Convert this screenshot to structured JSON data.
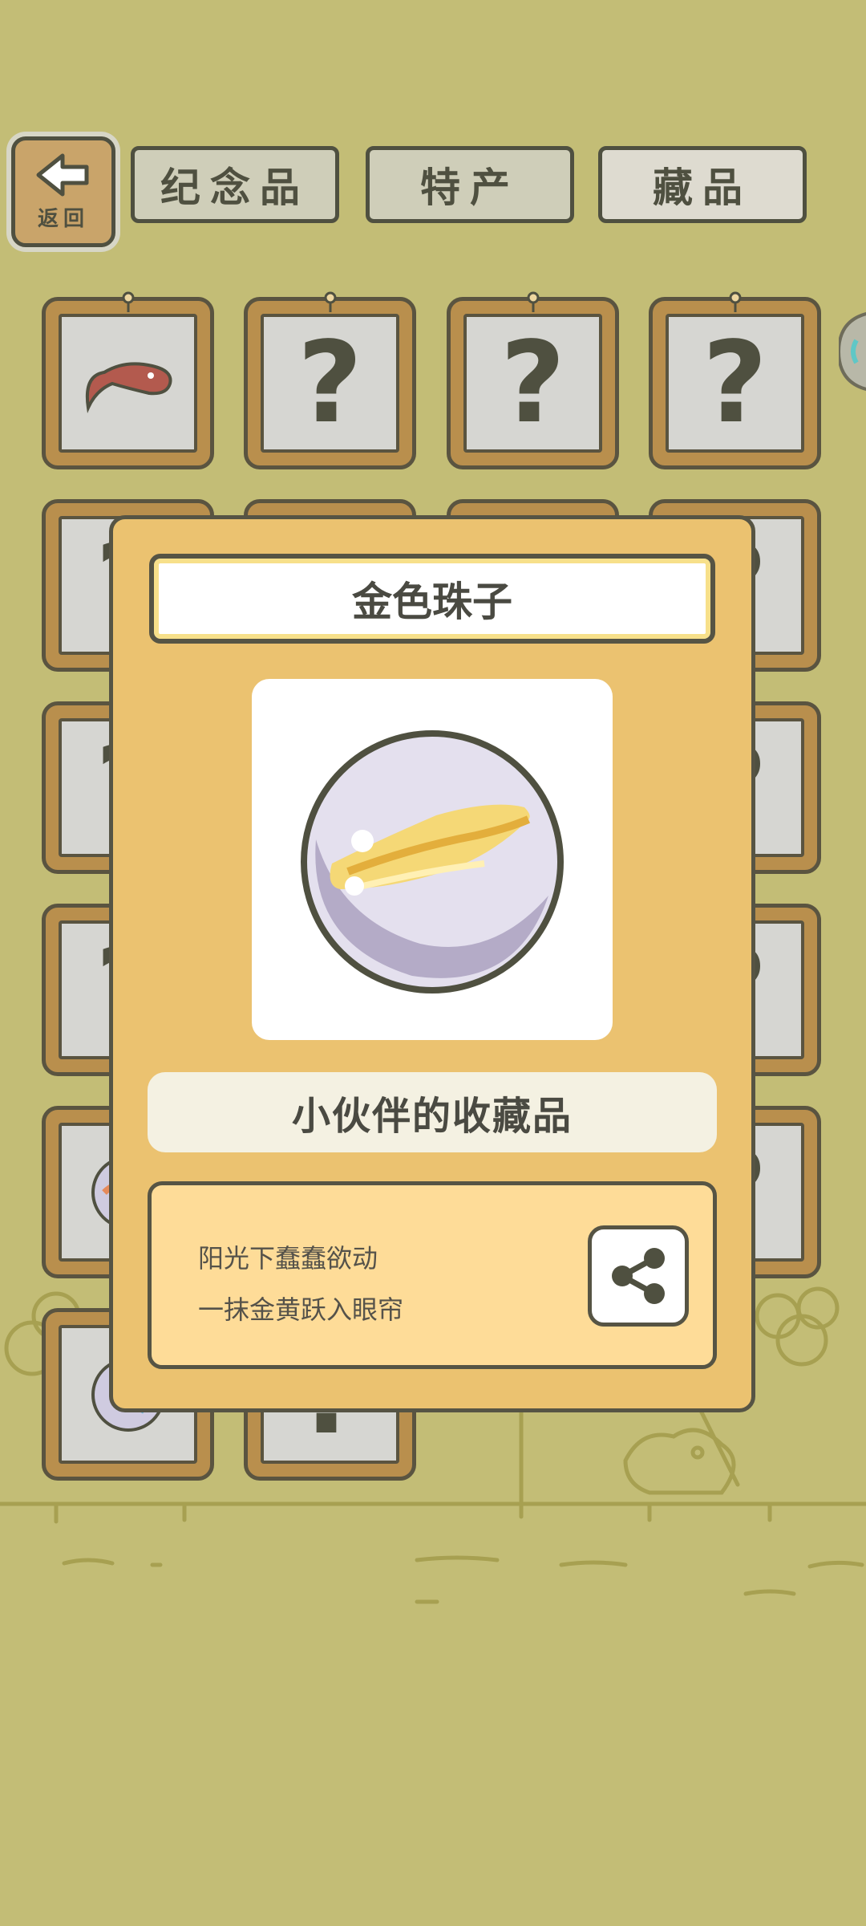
{
  "back_button": {
    "label": "返回",
    "icon": "left-arrow-icon"
  },
  "tabs": [
    {
      "label": "纪念品",
      "active": false
    },
    {
      "label": "特产",
      "active": false
    },
    {
      "label": "藏品",
      "active": true
    }
  ],
  "grid": {
    "unknown_symbol": "?",
    "row1": [
      "red-fish-item",
      "unknown",
      "unknown",
      "unknown"
    ]
  },
  "modal": {
    "title": "金色珠子",
    "category": "小伙伴的收藏品",
    "description_lines": [
      "阳光下蠢蠢欲动",
      "一抹金黄跃入眼帘"
    ],
    "share_icon": "share-icon"
  },
  "colors": {
    "background": "#c3bd76",
    "modal": "#ebc270",
    "desc_box": "#fedc98",
    "outline": "#565444"
  }
}
